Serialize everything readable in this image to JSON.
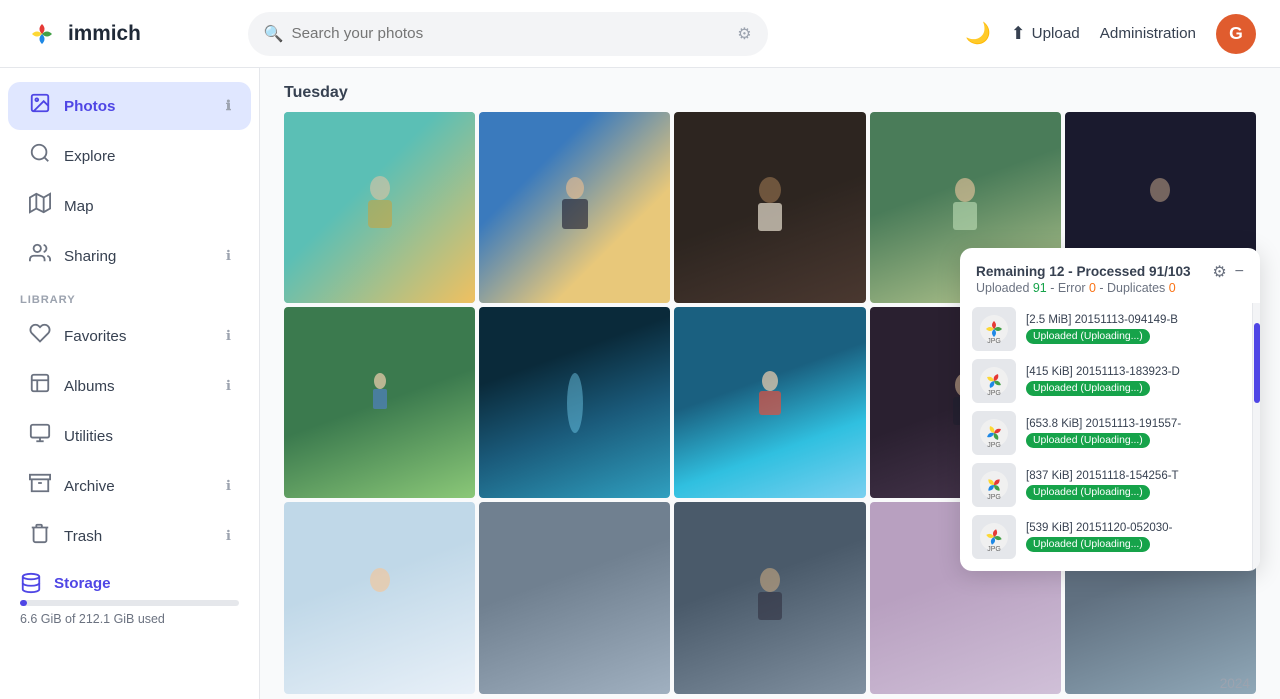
{
  "topbar": {
    "logo_text": "immich",
    "search_placeholder": "Search your photos",
    "upload_label": "Upload",
    "admin_label": "Administration",
    "avatar_letter": "G"
  },
  "sidebar": {
    "nav_items": [
      {
        "id": "photos",
        "label": "Photos",
        "icon": "🖼",
        "active": true,
        "has_info": true
      },
      {
        "id": "explore",
        "label": "Explore",
        "icon": "🔍",
        "active": false,
        "has_info": false
      },
      {
        "id": "map",
        "label": "Map",
        "icon": "🗺",
        "active": false,
        "has_info": false
      },
      {
        "id": "sharing",
        "label": "Sharing",
        "icon": "👤",
        "active": false,
        "has_info": true
      }
    ],
    "library_label": "LIBRARY",
    "library_items": [
      {
        "id": "favorites",
        "label": "Favorites",
        "icon": "♡",
        "has_info": true
      },
      {
        "id": "albums",
        "label": "Albums",
        "icon": "📕",
        "has_info": true
      },
      {
        "id": "utilities",
        "label": "Utilities",
        "icon": "🗂",
        "has_info": false
      },
      {
        "id": "archive",
        "label": "Archive",
        "icon": "📦",
        "has_info": true
      },
      {
        "id": "trash",
        "label": "Trash",
        "icon": "🗑",
        "has_info": true
      }
    ],
    "storage_label": "Storage",
    "storage_used": "6.6 GiB of 212.1 GiB used",
    "storage_percent": "3.1"
  },
  "main": {
    "section_title": "Tuesday",
    "year_label": "2024"
  },
  "upload_panel": {
    "title": "Remaining 12 - Processed 91/103",
    "uploaded_label": "Uploaded",
    "uploaded_count": "91",
    "error_label": "Error",
    "error_count": "0",
    "duplicates_label": "Duplicates",
    "duplicates_count": "0",
    "subtitle": "Uploaded 91 - Error 0 - Duplicates 0",
    "items": [
      {
        "id": 1,
        "size": "[2.5 MiB]",
        "filename": "20151113-094149-B",
        "status": "Uploaded (Uploading...)"
      },
      {
        "id": 2,
        "size": "[415 KiB]",
        "filename": "20151113-183923-D",
        "status": "Uploaded (Uploading...)"
      },
      {
        "id": 3,
        "size": "[653.8 KiB]",
        "filename": "20151113-191557-",
        "status": "Uploaded (Uploading...)"
      },
      {
        "id": 4,
        "size": "[837 KiB]",
        "filename": "20151118-154256-T",
        "status": "Uploaded (Uploading...)"
      },
      {
        "id": 5,
        "size": "[539 KiB]",
        "filename": "20151120-052030-",
        "status": "Uploaded (Uploading...)"
      }
    ]
  }
}
